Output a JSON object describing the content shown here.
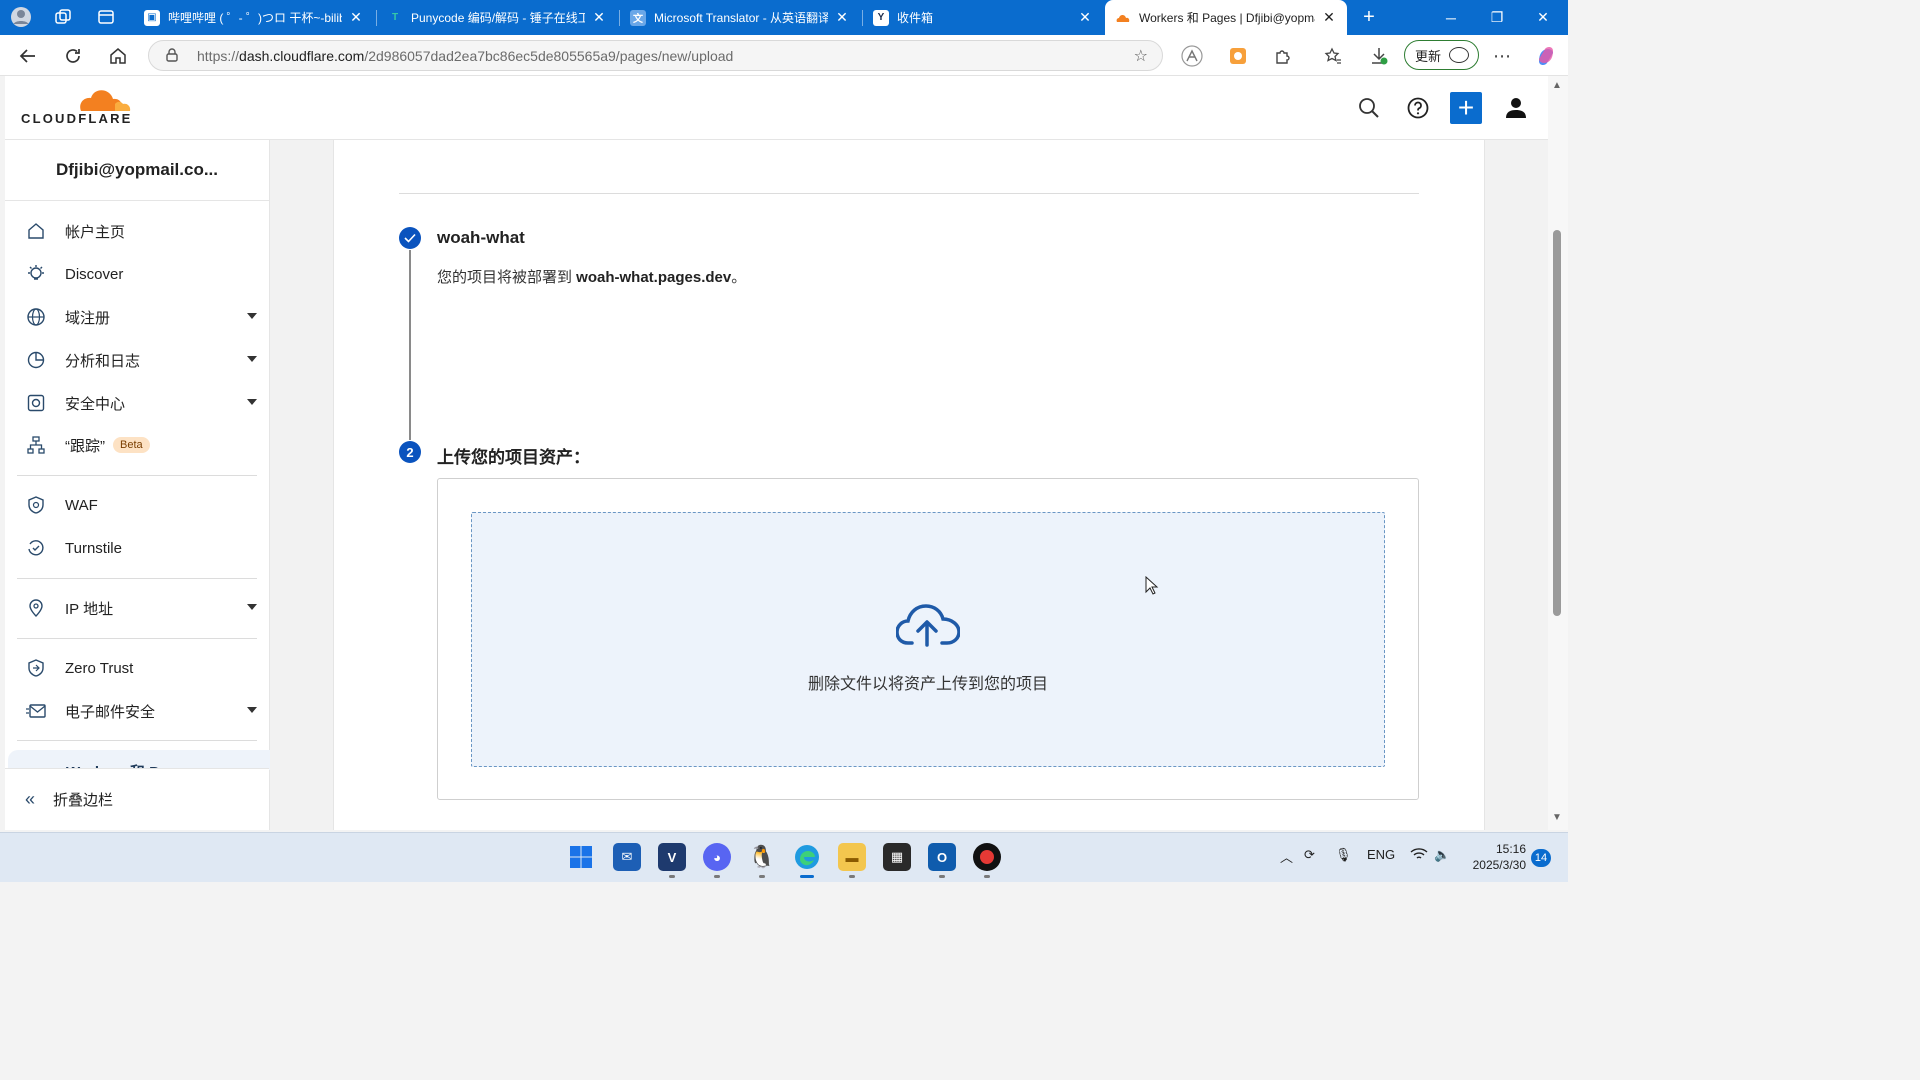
{
  "browser": {
    "tabs": [
      {
        "title": "哔哩哔哩 ( ゜- ゜)つロ 干杯~-bilibili",
        "favicon": "bilibili-icon",
        "active": false
      },
      {
        "title": "Punycode 编码/解码 - 锤子在线工具",
        "favicon": "punycode-icon",
        "active": false
      },
      {
        "title": "Microsoft Translator - 从英语翻译",
        "favicon": "translator-icon",
        "active": false
      },
      {
        "title": "收件箱",
        "favicon": "yopmail-icon",
        "active": false
      },
      {
        "title": "Workers 和 Pages | Dfjibi@yopmail.com",
        "favicon": "cloudflare-icon",
        "active": true
      }
    ],
    "url_prefix": "https://",
    "url_domain": "dash.cloudflare.com",
    "url_path": "/2d986057dad2ea7bc86ec5de805565a9/pages/new/upload",
    "update_label": "更新"
  },
  "cloudflare": {
    "logo_text": "CLOUDFLARE",
    "brand_color": "#f38020",
    "accent_color": "#0a53be"
  },
  "sidebar": {
    "account": "Dfjibi@yopmail.co...",
    "items": [
      {
        "label": "帐户主页",
        "icon": "home-icon"
      },
      {
        "label": "Discover",
        "icon": "lightbulb-icon"
      },
      {
        "label": "域注册",
        "icon": "globe-icon"
      },
      {
        "label": "分析和日志",
        "icon": "pie-chart-icon"
      },
      {
        "label": "安全中心",
        "icon": "security-center-icon"
      },
      {
        "label": "“跟踪”",
        "icon": "trace-icon",
        "badge": "Beta"
      },
      {
        "label": "WAF",
        "icon": "waf-shield-icon"
      },
      {
        "label": "Turnstile",
        "icon": "turnstile-icon"
      },
      {
        "label": "IP 地址",
        "icon": "location-pin-icon"
      },
      {
        "label": "Zero Trust",
        "icon": "zero-trust-icon"
      },
      {
        "label": "电子邮件安全",
        "icon": "email-security-icon"
      },
      {
        "label": "Workers 和 Pages",
        "icon": "workers-icon"
      }
    ],
    "collapse_label": "折叠边栏"
  },
  "main": {
    "step1": {
      "title": "woah-what",
      "desc_prefix": "您的项目将被部署到 ",
      "desc_domain": "woah-what.pages.dev",
      "desc_suffix": "。"
    },
    "step2": {
      "number": "2",
      "title": "上传您的项目资产："
    },
    "dropzone_text": "删除文件以将资产上传到您的项目"
  },
  "taskbar": {
    "apps": [
      "start-icon",
      "mail-app-icon",
      "vscode-like-icon",
      "discord-icon",
      "qq-icon",
      "edge-icon",
      "file-explorer-icon",
      "capture-icon",
      "outlook-icon",
      "record-icon"
    ],
    "lang": "ENG",
    "time": "15:16",
    "date": "2025/3/30",
    "notifications": "14"
  }
}
